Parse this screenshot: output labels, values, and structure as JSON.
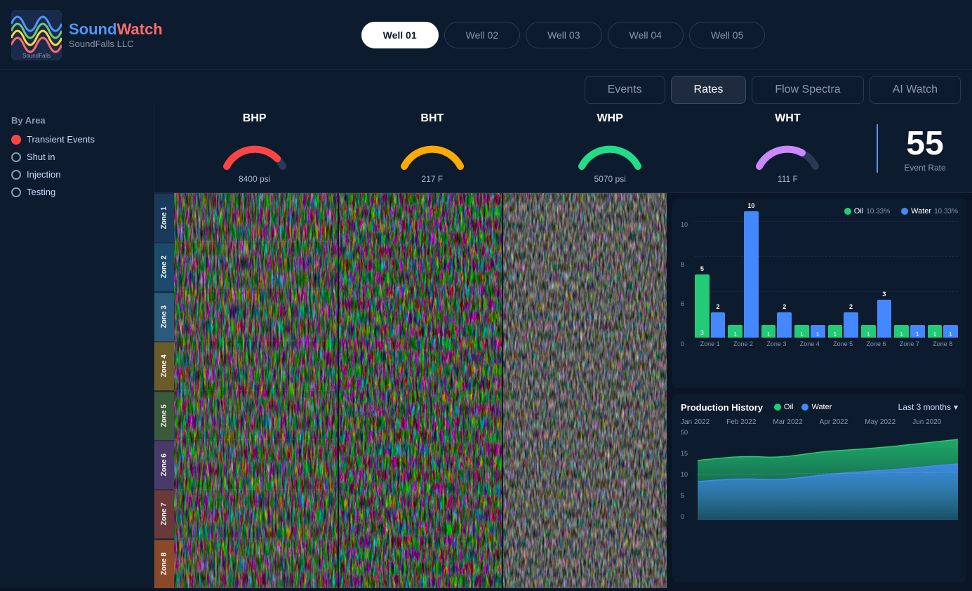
{
  "app": {
    "title": "SoundWatch",
    "title_sound": "Sound",
    "title_watch": "Watch",
    "subtitle": "SoundFalls LLC"
  },
  "wells": {
    "tabs": [
      {
        "id": "well01",
        "label": "Well 01",
        "active": true
      },
      {
        "id": "well02",
        "label": "Well 02",
        "active": false
      },
      {
        "id": "well03",
        "label": "Well 03",
        "active": false
      },
      {
        "id": "well04",
        "label": "Well 04",
        "active": false
      },
      {
        "id": "well05",
        "label": "Well 05",
        "active": false
      }
    ]
  },
  "sub_tabs": {
    "tabs": [
      {
        "id": "events",
        "label": "Events",
        "active": false
      },
      {
        "id": "rates",
        "label": "Rates",
        "active": true
      },
      {
        "id": "flow_spectra",
        "label": "Flow Spectra",
        "active": false
      },
      {
        "id": "ai_watch",
        "label": "AI Watch",
        "active": false
      }
    ]
  },
  "sidebar": {
    "title": "By Area",
    "items": [
      {
        "label": "Transient Events",
        "type": "filled"
      },
      {
        "label": "Shut in",
        "type": "empty"
      },
      {
        "label": "Injection",
        "type": "empty"
      },
      {
        "label": "Testing",
        "type": "empty"
      }
    ]
  },
  "gauges": {
    "bhp": {
      "label": "BHP",
      "value": "8400 psi",
      "color": "#ff4444",
      "pct": 60
    },
    "bht": {
      "label": "BHT",
      "value": "217 F",
      "color": "#ffaa00",
      "pct": 75
    },
    "whp": {
      "label": "WHP",
      "value": "5070 psi",
      "color": "#22dd88",
      "pct": 80
    },
    "wht": {
      "label": "WHT",
      "value": "111 F",
      "color": "#cc88ff",
      "pct": 50
    },
    "event_rate": {
      "number": "55",
      "label": "Event Rate"
    }
  },
  "zones": [
    {
      "label": "Zone 1",
      "class": "z1"
    },
    {
      "label": "Zone 2",
      "class": "z2"
    },
    {
      "label": "Zone 3",
      "class": "z3"
    },
    {
      "label": "Zone 4",
      "class": "z4"
    },
    {
      "label": "Zone 5",
      "class": "z5"
    },
    {
      "label": "Zone 6",
      "class": "z6"
    },
    {
      "label": "Zone 7",
      "class": "z7"
    },
    {
      "label": "Zone 8",
      "class": "z8"
    }
  ],
  "bar_chart": {
    "legend": [
      {
        "label": "Oil",
        "color": "#22cc77",
        "pct": "10.33%"
      },
      {
        "label": "Water",
        "color": "#4488ff",
        "pct": "10.33%"
      }
    ],
    "zones": [
      {
        "name": "Zone 1",
        "oil": 3,
        "water": 2,
        "total": 5
      },
      {
        "name": "Zone 2",
        "oil": 1,
        "water": 10,
        "total": 10
      },
      {
        "name": "Zone 3",
        "oil": 1,
        "water": 2,
        "total": 2
      },
      {
        "name": "Zone 4",
        "oil": 1,
        "water": 1,
        "total": 1
      },
      {
        "name": "Zone 5",
        "oil": 1,
        "water": 2,
        "total": 2
      },
      {
        "name": "Zone 6",
        "oil": 1,
        "water": 3,
        "total": 3
      },
      {
        "name": "Zone 7",
        "oil": 1,
        "water": 1,
        "total": 1
      },
      {
        "name": "Zone 8",
        "oil": 1,
        "water": 1,
        "total": 1
      }
    ],
    "y_max": 10,
    "y_labels": [
      "10",
      "8",
      "6",
      "0"
    ]
  },
  "production_history": {
    "title": "Production History",
    "time_selector": "Last 3 months",
    "legend": [
      {
        "label": "Oil",
        "color": "#22cc77"
      },
      {
        "label": "Water",
        "color": "#4488ff"
      }
    ],
    "months": [
      "Jan 2022",
      "Feb 2022",
      "Mar 2022",
      "Apr 2022",
      "May 2022",
      "Jun 2020"
    ],
    "y_labels": [
      "50",
      "15",
      "10",
      "5",
      "0"
    ]
  }
}
